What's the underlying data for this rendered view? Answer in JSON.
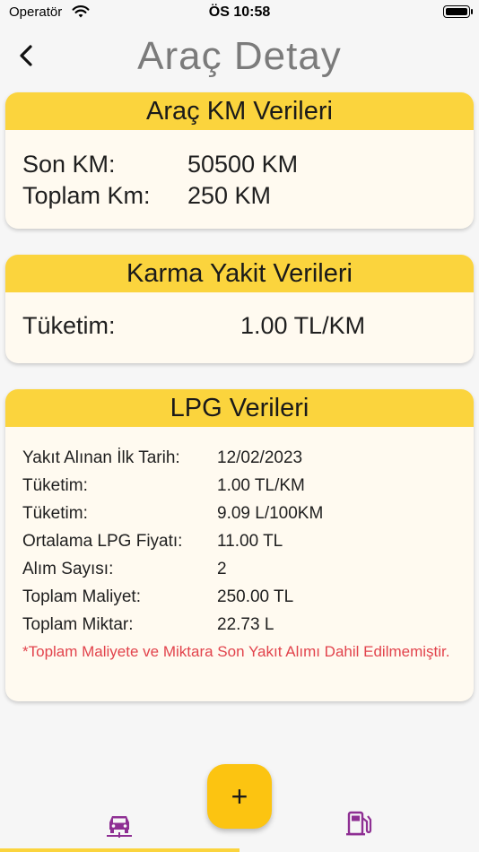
{
  "status_bar": {
    "carrier": "Operatör",
    "time": "ÖS 10:58",
    "icons": [
      "wifi-icon",
      "battery-icon"
    ]
  },
  "header": {
    "title": "Araç Detay",
    "back_icon": "chevron-left-icon"
  },
  "km_card": {
    "title": "Araç KM Verileri",
    "rows": [
      {
        "label": "Son KM:",
        "value": "50500 KM"
      },
      {
        "label": "Toplam Km:",
        "value": "250 KM"
      }
    ]
  },
  "fuel_card": {
    "title": "Karma Yakit Verileri",
    "rows": [
      {
        "label": "Tüketim:",
        "value": "1.00 TL/KM"
      }
    ]
  },
  "lpg_card": {
    "title": "LPG Verileri",
    "rows": [
      {
        "label": "Yakıt Alınan İlk Tarih:",
        "value": "12/02/2023"
      },
      {
        "label": "Tüketim:",
        "value": "1.00 TL/KM"
      },
      {
        "label": "Tüketim:",
        "value": "9.09 L/100KM"
      },
      {
        "label": "Ortalama LPG Fiyatı:",
        "value": "11.00 TL"
      },
      {
        "label": "Alım Sayısı:",
        "value": "2"
      },
      {
        "label": "Toplam Maliyet:",
        "value": "250.00 TL"
      },
      {
        "label": "Toplam Miktar:",
        "value": "22.73 L"
      }
    ],
    "note": "*Toplam Maliyete ve Miktara Son Yakıt Alımı Dahil Edilmemiştir."
  },
  "bottom_bar": {
    "fab_label": "+",
    "tabs": [
      {
        "icon": "car-icon",
        "active": true
      },
      {
        "icon": "fuel-pump-icon",
        "active": false
      }
    ]
  },
  "colors": {
    "accent": "#fbd43d",
    "fab": "#fcc411",
    "card_background": "#fffaf0",
    "tab_icon": "#8e2f93",
    "note_text": "#e2434c",
    "title_text": "#7b7b7b"
  }
}
